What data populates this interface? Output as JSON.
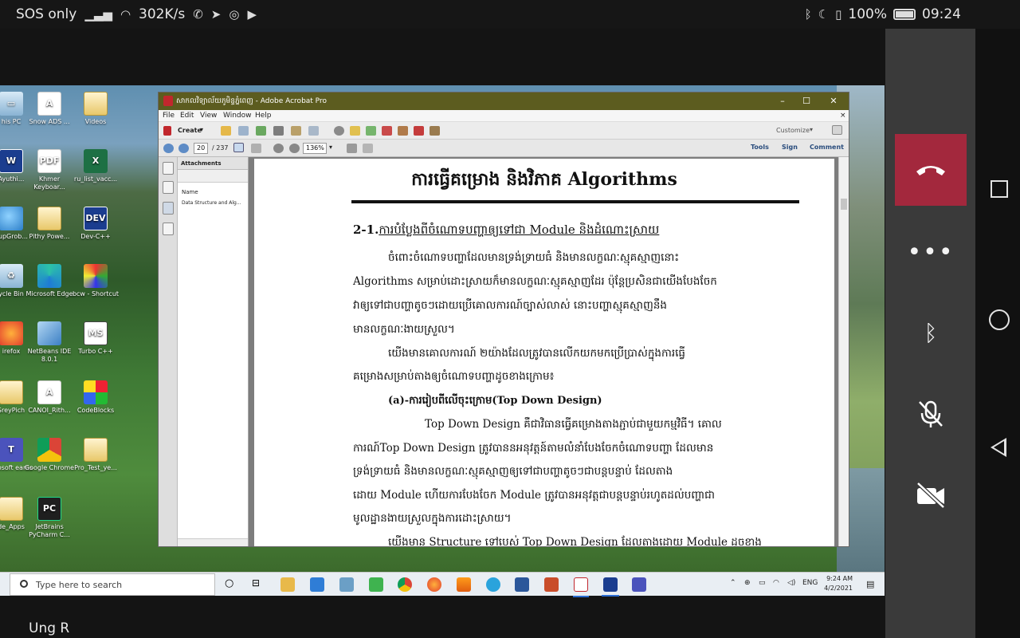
{
  "status_bar": {
    "network_label": "SOS only",
    "speed": "302K/s",
    "battery_percent": "100%",
    "time": "09:24"
  },
  "desktop": {
    "icons": [
      {
        "label": "his PC",
        "icon": "this-pc-icon"
      },
      {
        "label": "Snow ADS ...",
        "icon": "pdf-file-icon"
      },
      {
        "label": "Videos",
        "icon": "folder-icon"
      },
      {
        "label": "Ayuthi...",
        "icon": "word-file-icon"
      },
      {
        "label": "Khmer Keyboar...",
        "icon": "pdf-file-icon"
      },
      {
        "label": "ru_list_vacc...",
        "icon": "excel-file-icon"
      },
      {
        "label": "oupGrob...",
        "icon": "globe-icon"
      },
      {
        "label": "Pithy Powe...",
        "icon": "file-icon"
      },
      {
        "label": "Dev-C++",
        "icon": "devcpp-icon"
      },
      {
        "label": "ycle Bin",
        "icon": "recycle-bin-icon"
      },
      {
        "label": "Microsoft Edge",
        "icon": "edge-icon"
      },
      {
        "label": "bcw - Shortcut",
        "icon": "bcw-icon"
      },
      {
        "label": "irefox",
        "icon": "firefox-icon"
      },
      {
        "label": "NetBeans IDE 8.0.1",
        "icon": "netbeans-icon"
      },
      {
        "label": "Turbo C++",
        "icon": "turbo-cpp-icon"
      },
      {
        "label": "SreyPich",
        "icon": "file-icon"
      },
      {
        "label": "CANOI_Rith...",
        "icon": "pdf-file-icon"
      },
      {
        "label": "CodeBlocks",
        "icon": "codeblocks-icon"
      },
      {
        "label": "icrosoft eams",
        "icon": "teams-icon"
      },
      {
        "label": "Google Chrome",
        "icon": "chrome-icon"
      },
      {
        "label": "Pro_Test_ye...",
        "icon": "file-icon"
      },
      {
        "label": "de_Apps",
        "icon": "file-icon"
      },
      {
        "label": "JetBrains PyCharm C...",
        "icon": "pycharm-icon"
      }
    ]
  },
  "acrobat": {
    "title": "សាកលវិទ្យាល័យភូមិន្ទភ្នំពេញ - Adobe Acrobat Pro",
    "menu": [
      "File",
      "Edit",
      "View",
      "Window",
      "Help"
    ],
    "create_label": "Create",
    "customize_label": "Customize",
    "page_current": "20",
    "page_total": "/ 237",
    "zoom": "136%",
    "pane_links": [
      "Tools",
      "Sign",
      "Comment"
    ],
    "attachments": {
      "title": "Attachments",
      "column_name": "Name",
      "item": "Data Structure and Alg..."
    },
    "page": {
      "title": "ការធ្វើគម្រោង និងវិភាគ Algorithms",
      "heading_num": "2-1.",
      "heading_text": "ការបំប្លែងពីចំណោទបញ្ហាឲ្យទៅជា Module និងដំណោះស្រាយ",
      "lines": [
        "ចំពោះចំណោទបញ្ហាដែលមានទ្រង់ទ្រាយធំ      និងមានលក្ខណៈស្មុគស្មាញនោះ",
        "Algorithms សម្រាប់ដោះស្រាយក៏មានលក្ខណៈស្មុគស្មាញដែរ ប៉ុន្តែប្រសិនជាយើងបែងចែក",
        "វាឲ្យទៅជាបញ្ហាតូចៗដោយប្រើគោលការណ៍ច្បាស់លាស់       នោះបញ្ហាស្មុគស្មាញនឹង",
        "មានលក្ខណៈងាយស្រួល។",
        "យើងមានគោលការណ៍     ២យ៉ាងដែលត្រូវបានលើកយកមកប្រើប្រាស់ក្នុងការធ្វើ",
        "គម្រោងសម្រាប់តាងឲ្យចំណោទបញ្ហាដូចខាងក្រោម៖",
        "(a)-ការរៀបពីលើចុះក្រោម(Top Down Design)",
        "Top Down Design គឺជាវិធានធ្វើគម្រោងតាងភ្ជាប់ជាមួយកម្មវិធី។ គោល",
        "ការណ៍Top Down Design ត្រូវបាននអនុវត្តន៍តាមលំនាំបែងចែកចំណោទបញ្ហា    ដែលមាន",
        "ទ្រង់ទ្រាយធំ    និងមានលក្ខណៈស្មុគស្មាញឲ្យទៅជាបញ្ហាតូចៗជាបន្តបន្ទាប់    ដែលតាង",
        "ដោយ Module ហើយការបែងចែក Module ត្រូវបានអនុវត្តជាបន្តបន្ទាប់រហូតដល់បញ្ហាជា",
        "មូលដ្ឋានងាយស្រួលក្នុងការដោះស្រាយ។",
        "យើងមាន Structure ទៅបេស់ Top Down Design ដែលតាងដោយ Module ដូចខាង"
      ]
    }
  },
  "taskbar": {
    "search_placeholder": "Type here to search",
    "language": "ENG",
    "clock_time": "9:24 AM",
    "clock_date": "4/2/2021"
  },
  "call": {
    "caller_name": "Ung R"
  }
}
